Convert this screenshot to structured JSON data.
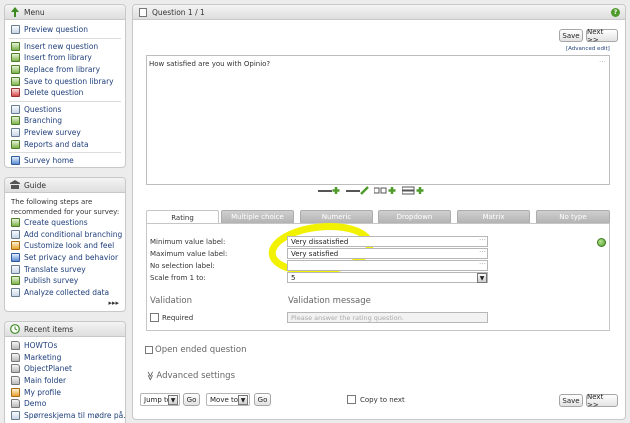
{
  "menu": {
    "title": "Menu",
    "items": [
      {
        "label": "Preview question",
        "icon": "preview-icon"
      },
      {
        "label": "Insert new question",
        "icon": "insert-icon"
      },
      {
        "label": "Insert from library",
        "icon": "library-icon"
      },
      {
        "label": "Replace from library",
        "icon": "replace-icon"
      },
      {
        "label": "Save to question library",
        "icon": "save-library-icon"
      },
      {
        "label": "Delete question",
        "icon": "delete-icon"
      },
      {
        "label": "Questions",
        "icon": "questions-icon"
      },
      {
        "label": "Branching",
        "icon": "branching-icon"
      },
      {
        "label": "Preview survey",
        "icon": "preview-survey-icon"
      },
      {
        "label": "Reports and data",
        "icon": "reports-icon"
      },
      {
        "label": "Survey home",
        "icon": "survey-home-icon"
      }
    ]
  },
  "guide": {
    "title": "Guide",
    "intro_line1": "The following steps are",
    "intro_line2": "recommended for your survey:",
    "steps": [
      "Create questions",
      "Add conditional branching",
      "Customize look and feel",
      "Set privacy and behavior",
      "Translate survey",
      "Publish survey",
      "Analyze collected data"
    ],
    "more": "▸▸▸"
  },
  "recent": {
    "title": "Recent items",
    "items": [
      "HOWTOs",
      "Marketing",
      "ObjectPlanet",
      "Main folder",
      "My profile",
      "Demo",
      "Spørreskjema til mødre på..."
    ]
  },
  "question": {
    "title": "Question 1 / 1",
    "save_label": "Save",
    "next_label": "Next >>",
    "advanced_edit": "[Advanced edit]",
    "text": "How satisfied are you with Opinio?",
    "tabs": [
      "Rating",
      "Multiple choice",
      "Numeric",
      "Dropdown",
      "Matrix",
      "No type"
    ],
    "active_tab": "Rating",
    "fields": {
      "min_label": "Minimum value label:",
      "min_value": "Very dissatisfied",
      "max_label": "Maximum value label:",
      "max_value": "Very satisfied",
      "nosel_label": "No selection label:",
      "nosel_value": "",
      "scale_label": "Scale from 1 to:",
      "scale_value": "5"
    },
    "validation_heading": "Validation",
    "validation_message_heading": "Validation message",
    "required_label": "Required",
    "validation_placeholder": "Please answer the rating question.",
    "open_ended_label": "Open ended question",
    "advanced_settings_label": "Advanced settings",
    "advanced_settings_arrow": "≫"
  },
  "footer": {
    "jump_label": "Jump to",
    "go_label": "Go",
    "move_label": "Move to",
    "go2_label": "Go",
    "copy_label": "Copy to next",
    "save_label": "Save",
    "next_label": "Next >>"
  },
  "colors": {
    "highlight": "#f2f200",
    "link": "#1f3f7a",
    "accent_green": "#5ea834"
  }
}
